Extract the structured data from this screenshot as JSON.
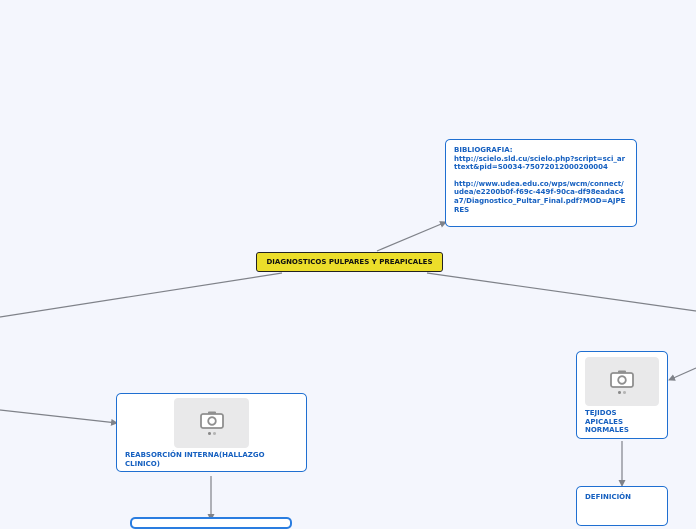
{
  "mindmap": {
    "central": "DIAGNOSTICOS PULPARES Y PREAPICALES",
    "bibliography": {
      "title": "BIBLIOGRAFIA:",
      "link1": "http://scielo.sld.cu/scielo.php?script=sci_arttext&pid=S0034-75072012000200004",
      "link2": "http://www.udea.edu.co/wps/wcm/connect/udea/e2200b0f-f69c-449f-90ca-df98eadac4a7/Diagnostico_Pultar_Final.pdf?MOD=AJPERES"
    },
    "reabsorcion": {
      "label": "REABSORCIÓN INTERNA(HALLAZGO CLINICO)",
      "icon": "camera-icon"
    },
    "tejidos": {
      "label": "TEJIDOS APICALES NORMALES",
      "icon": "camera-icon"
    },
    "definicion": {
      "label": "DEFINICIÓN"
    }
  },
  "colors": {
    "background": "#f4f6fd",
    "node_border": "#1f6fd1",
    "node_text": "#1660c0",
    "central_fill": "#ecde2a",
    "connector": "#7f8289"
  }
}
